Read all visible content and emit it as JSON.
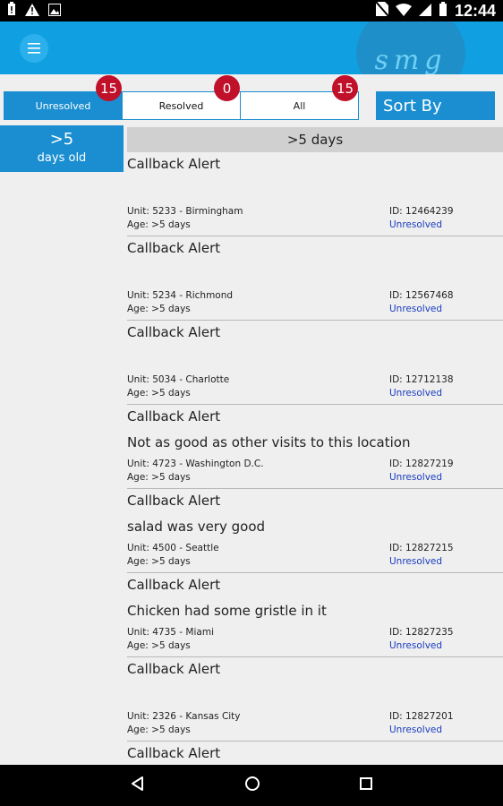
{
  "status_bar": {
    "time": "12:44",
    "left_icons": [
      "battery-alert-icon",
      "warning-icon",
      "image-icon"
    ],
    "right_icons": [
      "no-sim-icon",
      "wifi-icon",
      "signal-icon",
      "battery-icon"
    ]
  },
  "app_bar": {
    "color": "#10a0e2",
    "logo_text": "smg"
  },
  "tabs": [
    {
      "label": "Unresolved",
      "count": "15",
      "active": true
    },
    {
      "label": "Resolved",
      "count": "0",
      "active": false
    },
    {
      "label": "All",
      "count": "15",
      "active": false
    }
  ],
  "sort_button": {
    "label": "Sort By"
  },
  "age_filter": {
    "value": ">5",
    "unit": "days old"
  },
  "section_header": ">5 days",
  "items": [
    {
      "title": "Callback Alert",
      "comment": "",
      "unit": "Unit: 5233 - Birmingham",
      "age": "Age: >5 days",
      "id": "ID: 12464239",
      "status": "Unresolved"
    },
    {
      "title": "Callback Alert",
      "comment": "",
      "unit": "Unit: 5234 - Richmond",
      "age": "Age: >5 days",
      "id": "ID: 12567468",
      "status": "Unresolved"
    },
    {
      "title": "Callback Alert",
      "comment": "",
      "unit": "Unit: 5034 - Charlotte",
      "age": "Age: >5 days",
      "id": "ID: 12712138",
      "status": "Unresolved"
    },
    {
      "title": "Callback Alert",
      "comment": "Not as good as other visits to this location",
      "unit": "Unit: 4723 - Washington D.C.",
      "age": "Age: >5 days",
      "id": "ID: 12827219",
      "status": "Unresolved"
    },
    {
      "title": "Callback Alert",
      "comment": "salad was very good",
      "unit": "Unit: 4500 - Seattle",
      "age": "Age: >5 days",
      "id": "ID: 12827215",
      "status": "Unresolved"
    },
    {
      "title": "Callback Alert",
      "comment": "Chicken had some gristle in it",
      "unit": "Unit: 4735 - Miami",
      "age": "Age: >5 days",
      "id": "ID: 12827235",
      "status": "Unresolved"
    },
    {
      "title": "Callback Alert",
      "comment": "",
      "unit": "Unit: 2326 - Kansas City",
      "age": "Age: >5 days",
      "id": "ID: 12827201",
      "status": "Unresolved"
    },
    {
      "title": "Callback Alert",
      "comment": "",
      "unit": "",
      "age": "",
      "id": "",
      "status": ""
    }
  ],
  "nav_bar": [
    "back-icon",
    "home-icon",
    "recents-icon"
  ],
  "colors": {
    "accent": "#1a8ed0",
    "badge": "#c0102a",
    "status_link": "#1a3dbf"
  }
}
